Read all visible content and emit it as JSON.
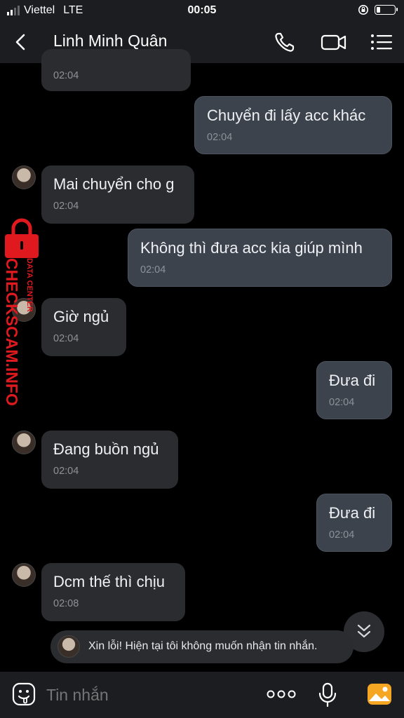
{
  "status_bar": {
    "carrier": "Viettel",
    "network": "LTE",
    "time": "00:05",
    "battery_level": 0.2
  },
  "header": {
    "title": "Linh Minh Quân",
    "back_icon": "chevron-left-icon",
    "icons": [
      "phone-icon",
      "video-call-icon",
      "menu-list-icon"
    ]
  },
  "messages": [
    {
      "dir": "in",
      "text": "",
      "time": "02:04"
    },
    {
      "dir": "out",
      "text": "Chuyển đi lấy acc khác",
      "time": "02:04"
    },
    {
      "dir": "in",
      "text": "Mai chuyển cho g",
      "time": "02:04"
    },
    {
      "dir": "out",
      "text": "Không thì đưa acc kia giúp mình",
      "time": "02:04"
    },
    {
      "dir": "in",
      "text": "Giờ ngủ",
      "time": "02:04"
    },
    {
      "dir": "out",
      "text": "Đưa đi",
      "time": "02:04"
    },
    {
      "dir": "in",
      "text": "Đang buồn ngủ",
      "time": "02:04"
    },
    {
      "dir": "out",
      "text": "Đưa đi",
      "time": "02:04"
    },
    {
      "dir": "in",
      "text": "Dcm thế thì chịu",
      "time": "02:08"
    }
  ],
  "watermark": {
    "brand": "CHECKSCAM.INFO",
    "sub": "DATA CENTER",
    "color": "#e0191e"
  },
  "notice": {
    "text": "Xin lỗi! Hiện tại tôi không muốn nhận tin nhắn."
  },
  "composer": {
    "placeholder": "Tin nhắn"
  },
  "colors": {
    "incoming_bubble": "#2b2c2f",
    "outgoing_bubble": "#3d434d",
    "background": "#000000",
    "photo_accent": "#f5a623"
  }
}
